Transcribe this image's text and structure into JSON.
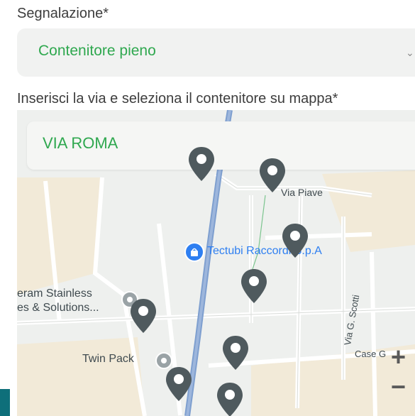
{
  "form": {
    "report_label": "Segnalazione*",
    "report_value": "Contenitore pieno",
    "street_label": "Inserisci la via e seleziona il contenitore su mappa*"
  },
  "map": {
    "search_value": "VIA ROMA",
    "labels": {
      "via_piave": "Via Piave",
      "poi_tectubi": "Tectubi Raccordi S.p.A",
      "stainless_1": "eram Stainless",
      "stainless_2": "es & Solutions...",
      "twin_pack": "Twin Pack",
      "via_scotti": "Via G. Scotti",
      "case": "Case G"
    },
    "zoom_in": "+",
    "zoom_out": "−"
  },
  "colors": {
    "accent_green": "#2fa84f",
    "pin_gray": "#4f5a5e",
    "poi_blue": "#2e7ff1",
    "road_blue": "#7e9fcf"
  }
}
